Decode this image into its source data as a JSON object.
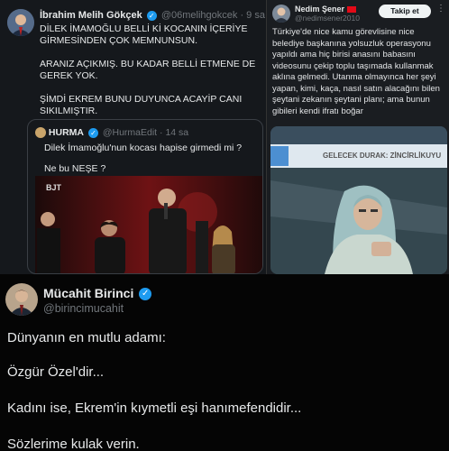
{
  "tweet1": {
    "display_name": "İbrahim Melih Gökçek",
    "handle": "@06melihgokcek",
    "time": "· 9 sa",
    "text": "DİLEK İMAMOĞLU BELLİ Kİ KOCANIN İÇERİYE GİRMESİNDEN ÇOK MEMNUNSUN.\n\nARANIZ AÇIKMIŞ. BU KADAR BELLİ ETMENE DE GEREK YOK.\n\nŞİMDİ EKREM BUNU DUYUNCA ACAYİP CANI SIKILMIŞTIR.",
    "quote": {
      "display_name": "HURMA",
      "handle": "@HurmaEdit",
      "time": "· 14 sa",
      "line1": "Dilek İmamoğlu'nun kocası hapise girmedi mi ?",
      "line2": "Ne bu NEŞE ?",
      "image_watermark": "BJT"
    }
  },
  "tweet2": {
    "display_name": "Nedim Şener",
    "handle": "@nedimsener2010",
    "follow_label": "Takip et",
    "text": "Türkiye'de nice kamu görevlisine nice belediye başkanına yolsuzluk operasyonu yapıldı ama hiç birisi anasını babasını videosunu çekip toplu taşımada kullanmak aklına gelmedi. Utanma olmayınca her şeyi yapan, kimi, kaça, nasıl satın alacağını bilen şeytani zekanın şeytani planı; ama bunun gibileri kendi ifratı boğar",
    "photo_sign": "GELECEK DURAK: ZİNCİRLİKUYU"
  },
  "tweet3": {
    "display_name": "Mücahit Birinci",
    "handle": "@birincimucahit",
    "lines": [
      "Dünyanın en mutlu adamı:",
      "Özgür Özel'dir...",
      "Kadını ise, Ekrem'in kıymetli eşi hanımefendidir...",
      "Sözlerime kulak verin."
    ]
  },
  "colors": {
    "verified": "#1d9bf0",
    "muted": "#71767b",
    "text": "#e7e9ea"
  }
}
